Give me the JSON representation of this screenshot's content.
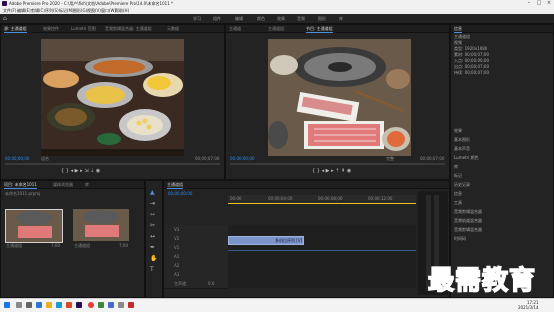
{
  "window": {
    "title": "Adobe Premiere Pro 2020 - C:\\用户\\fish\\文档\\Adobe\\Premiere Pro\\14.0\\未命名1011 *"
  },
  "menu": [
    "文件(F)",
    "编辑(E)",
    "剪辑(C)",
    "序列(S)",
    "标记(M)",
    "图形(G)",
    "视图(V)",
    "窗口(W)",
    "帮助(H)"
  ],
  "workspaces": [
    "学习",
    "组件",
    "编辑",
    "颜色",
    "效果",
    "音频",
    "图形",
    "库"
  ],
  "source_monitor": {
    "tabs": [
      "源: 主通道组",
      "效果控件",
      "Lumetri 范围",
      "音频剪辑混合器: 主通道组",
      "元数据"
    ],
    "timecode_in": "00;00;00;00",
    "fit": "适合",
    "timecode_out": "00;00;07;00"
  },
  "program_monitor": {
    "tabs": [
      "节目: 主通道组",
      "主通道",
      "主通道组"
    ],
    "timecode_in": "00;00;00;00",
    "fit": "完整",
    "timecode_out": "00;00;07;00"
  },
  "right_panel": {
    "header": "信息",
    "lines": [
      "主通道组",
      "视频",
      "类型: 1920x1080",
      "素材: 00;00;07;00",
      "入点: 00;00;00;00",
      "出点: 00;00;07;00",
      "持续: 00;00;07;00"
    ],
    "items": [
      "效果",
      "基本图形",
      "基本声音",
      "Lumetri 颜色",
      "库",
      "标记",
      "历史记录",
      "信息",
      "工具",
      "音频剪辑混合器",
      "音频轨道混合器",
      "音频剪辑混合器",
      "时间码"
    ]
  },
  "project_panel": {
    "tabs": [
      "项目: 未命名1011",
      "媒体浏览器",
      "库"
    ],
    "file": "未命名1011.prproj",
    "items": [
      {
        "label": "主通道组",
        "duration": "7;00"
      },
      {
        "label": "主通道组",
        "duration": "7;00"
      }
    ]
  },
  "timeline": {
    "tab": "主通道组",
    "timecode": "00;00;00;00",
    "ruler": [
      "00;00",
      "00;00;04;00",
      "00;00;08;00",
      "00;00;12;00"
    ],
    "tracks": [
      "V3",
      "V2",
      "V1",
      "A1",
      "A2",
      "A3",
      "主声道"
    ],
    "clip_label": "多机位序列 [V]",
    "master_value": "0.0"
  },
  "taskbar": {
    "time": "17:21",
    "date": "2021/3/14"
  },
  "watermark": "最需教育",
  "colors": {
    "timecode": "#2a8cf2",
    "clip": "#7b94c9",
    "accent": "#4a8fe0"
  }
}
